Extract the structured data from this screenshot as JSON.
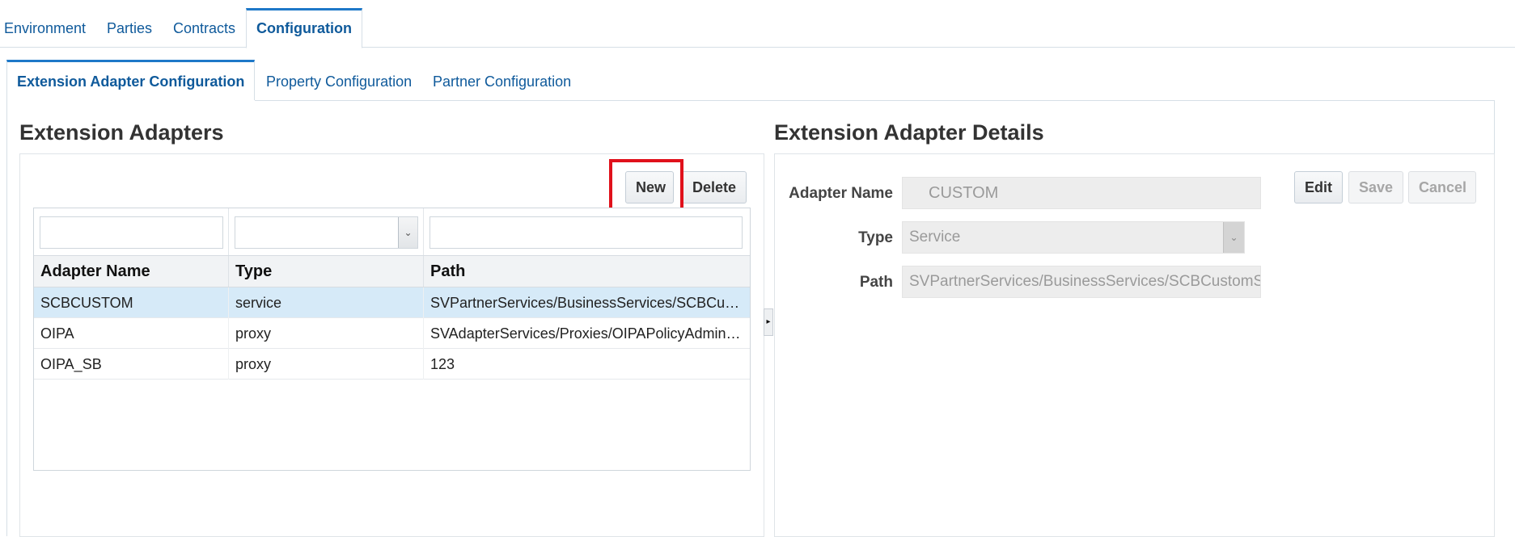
{
  "top_tabs": [
    {
      "label": "Environment"
    },
    {
      "label": "Parties"
    },
    {
      "label": "Contracts"
    },
    {
      "label": "Configuration",
      "active": true
    }
  ],
  "sub_tabs": [
    {
      "label": "Extension Adapter Configuration",
      "active": true
    },
    {
      "label": "Property Configuration"
    },
    {
      "label": "Partner Configuration"
    }
  ],
  "left_panel": {
    "title": "Extension Adapters",
    "new_label": "New",
    "delete_label": "Delete",
    "columns": [
      "Adapter Name",
      "Type",
      "Path"
    ],
    "rows": [
      {
        "name": "SCBCUSTOM",
        "type": "service",
        "path": "SVPartnerServices/BusinessServices/SCBCustomService",
        "selected": true
      },
      {
        "name": "OIPA",
        "type": "proxy",
        "path": "SVAdapterServices/Proxies/OIPAPolicyAdministration"
      },
      {
        "name": "OIPA_SB",
        "type": "proxy",
        "path": "123"
      }
    ]
  },
  "right_panel": {
    "title": "Extension Adapter Details",
    "edit_label": "Edit",
    "save_label": "Save",
    "cancel_label": "Cancel",
    "fields": {
      "adapter_name_label": "Adapter Name",
      "adapter_name_value": "CUSTOM",
      "type_label": "Type",
      "type_value": "Service",
      "path_label": "Path",
      "path_value": "SVPartnerServices/BusinessServices/SCBCustomSer"
    }
  },
  "colors": {
    "accent": "#1e78c8",
    "link": "#0f5a9b",
    "highlight": "#e0111b",
    "selected_row": "#d6eaf8"
  }
}
